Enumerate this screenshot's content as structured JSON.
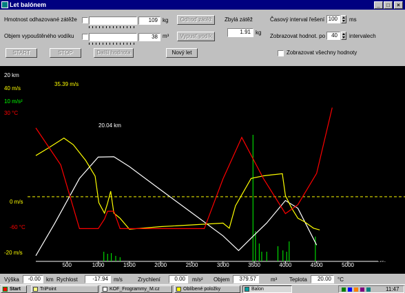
{
  "window": {
    "title": "Let balónem"
  },
  "controls": {
    "weight_label": "Hmotnost odhazované zátěže",
    "weight_value": "109",
    "weight_unit": "kg",
    "gas_label": "Objem vypouštěného vodíku",
    "gas_value": "38",
    "gas_unit": "m³",
    "drop_weight_button": "Odhoď zátěž",
    "release_gas_button": "Vypusť vodík",
    "remaining_label": "Zbylá zátěž",
    "remaining_value": "1.91",
    "remaining_unit": "kg",
    "start_button": "START",
    "stop_button": "STOP",
    "next_button": "Další hodnota",
    "new_button": "Nový let",
    "time_interval_label": "Časový interval řešení",
    "time_interval_value": "100",
    "time_interval_unit": "ms",
    "show_values_label": "Zobrazovat hodnot. po",
    "show_values_value": "40",
    "show_values_unit": "intervalech",
    "show_all_label": "Zobrazovat všechny hodnoty"
  },
  "plot": {
    "left_labels": [
      {
        "text": "20 km",
        "color": "#ffffff"
      },
      {
        "text": "40 m/s",
        "color": "#ffff00"
      },
      {
        "text": "10 m/s²",
        "color": "#00ff00"
      },
      {
        "text": "30 °C",
        "color": "#ff0000"
      },
      {
        "text": "0 m/s",
        "color": "#ffff00"
      },
      {
        "text": "-60 °C",
        "color": "#ff0000"
      },
      {
        "text": "-20 m/s",
        "color": "#ffff00"
      }
    ],
    "annotation_speed": "35.39 m/s",
    "annotation_height": "20.04 km",
    "x_ticks": [
      "500",
      "1000",
      "1500",
      "2000",
      "2500",
      "3000",
      "3500",
      "4000",
      "4500",
      "5000"
    ],
    "x_unit": "t/s",
    "colors": {
      "height": "#ffffff",
      "speed": "#ffff00",
      "accel": "#00ff00",
      "temp": "#ff0000"
    }
  },
  "chart_data": {
    "type": "line",
    "xlabel": "t/s",
    "xlim": [
      0,
      5000
    ],
    "series": [
      {
        "name": "height",
        "color": "#ffffff",
        "unit": "km",
        "x": [
          0,
          300,
          700,
          1000,
          1250,
          1500,
          2000,
          2600,
          3000,
          3250,
          3500,
          3700,
          4000,
          4200,
          4500
        ],
        "y": [
          -15.1,
          -6.4,
          5.9,
          11.7,
          11.8,
          9.1,
          2.8,
          -4.7,
          -9.7,
          -13.7,
          -9.5,
          -6.2,
          -0.1,
          -2.2,
          -12.2
        ]
      },
      {
        "name": "speed",
        "color": "#ffff00",
        "unit": "m/s",
        "x": [
          0,
          200,
          450,
          600,
          800,
          950,
          1010,
          1100,
          1150,
          1200,
          1250,
          1350,
          1500,
          2000,
          2500,
          3000,
          3100,
          3200,
          3450,
          3650,
          3800,
          3950,
          4000,
          4100,
          4200,
          4300,
          4450,
          4550
        ],
        "y": [
          25.4,
          29.7,
          35.4,
          31.6,
          22.6,
          13.7,
          -1.5,
          -7.4,
          -1.7,
          5.1,
          -7.4,
          -10.3,
          -16.6,
          -15.1,
          -14.1,
          -13.1,
          -16.0,
          -3.2,
          12.4,
          13.9,
          14.5,
          15.1,
          2.6,
          -4.6,
          -10.3,
          -12.2,
          -16.0,
          -17.0
        ]
      },
      {
        "name": "temp",
        "color": "#ff0000",
        "unit": "°C",
        "x": [
          0,
          400,
          700,
          1000,
          1100,
          1150,
          1250,
          1350,
          1600,
          2200,
          2700,
          3000,
          3300,
          3650,
          4000,
          4200,
          4500,
          4750
        ],
        "y": [
          30.0,
          -5.4,
          -66.3,
          -66.3,
          -57.2,
          -49.7,
          -49.7,
          -66.3,
          -66.3,
          -66.3,
          -66.3,
          -18.7,
          20.9,
          -18.7,
          -52.0,
          -43.4,
          -13.4,
          49.4
        ]
      }
    ]
  },
  "status": {
    "height_label": "Výška",
    "height_value": "-0.00",
    "height_unit": "km",
    "speed_label": "Rychlost",
    "speed_value": "-17.94",
    "speed_unit": "m/s",
    "accel_label": "Zrychlení",
    "accel_value": "0.00",
    "accel_unit": "m/s²",
    "volume_label": "Objem",
    "volume_value": "379.57",
    "volume_unit": "m³",
    "temp_label": "Teplota",
    "temp_value": "20.00",
    "temp_unit": "°C"
  },
  "taskbar": {
    "start": "Start",
    "tasks": [
      "TriPoint",
      "KOF_Frogrammy_M.cz",
      "Oblíbené položky",
      "Balon"
    ],
    "clock": "11:47"
  }
}
